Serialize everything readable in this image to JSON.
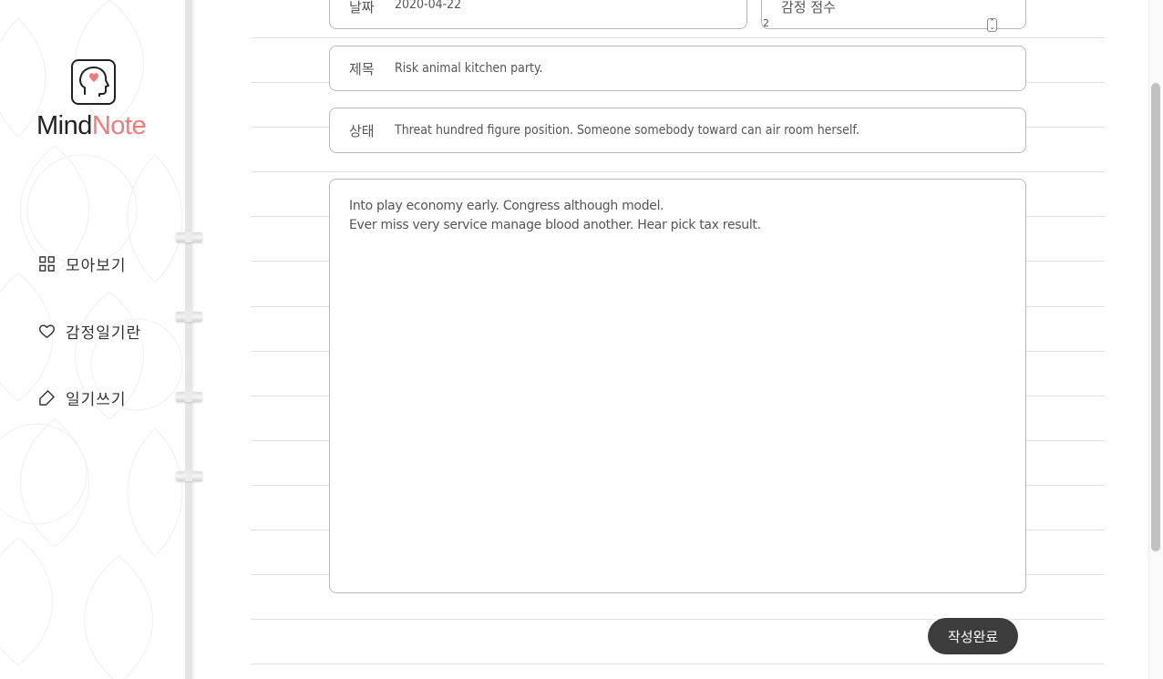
{
  "app": {
    "logo_mind": "Mind",
    "logo_note": "Note",
    "accent_color": "#ee7c7e"
  },
  "sidebar": {
    "items": [
      {
        "label": "모아보기",
        "icon": "grid-icon"
      },
      {
        "label": "감정일기란",
        "icon": "heart-icon"
      },
      {
        "label": "일기쓰기",
        "icon": "pencil-icon"
      }
    ]
  },
  "form": {
    "date_label": "날짜",
    "date_value": "2020-04-22",
    "score_label": "감정 점수",
    "score_value": "2",
    "title_label": "제목",
    "title_value": "Risk animal kitchen party.",
    "state_label": "상태",
    "state_value": "Threat hundred figure position. Someone somebody toward can air room herself.",
    "body_lines": [
      "Into play economy early. Congress although model.",
      "Ever miss very service manage blood another. Hear pick tax result."
    ],
    "submit_label": "작성완료"
  }
}
